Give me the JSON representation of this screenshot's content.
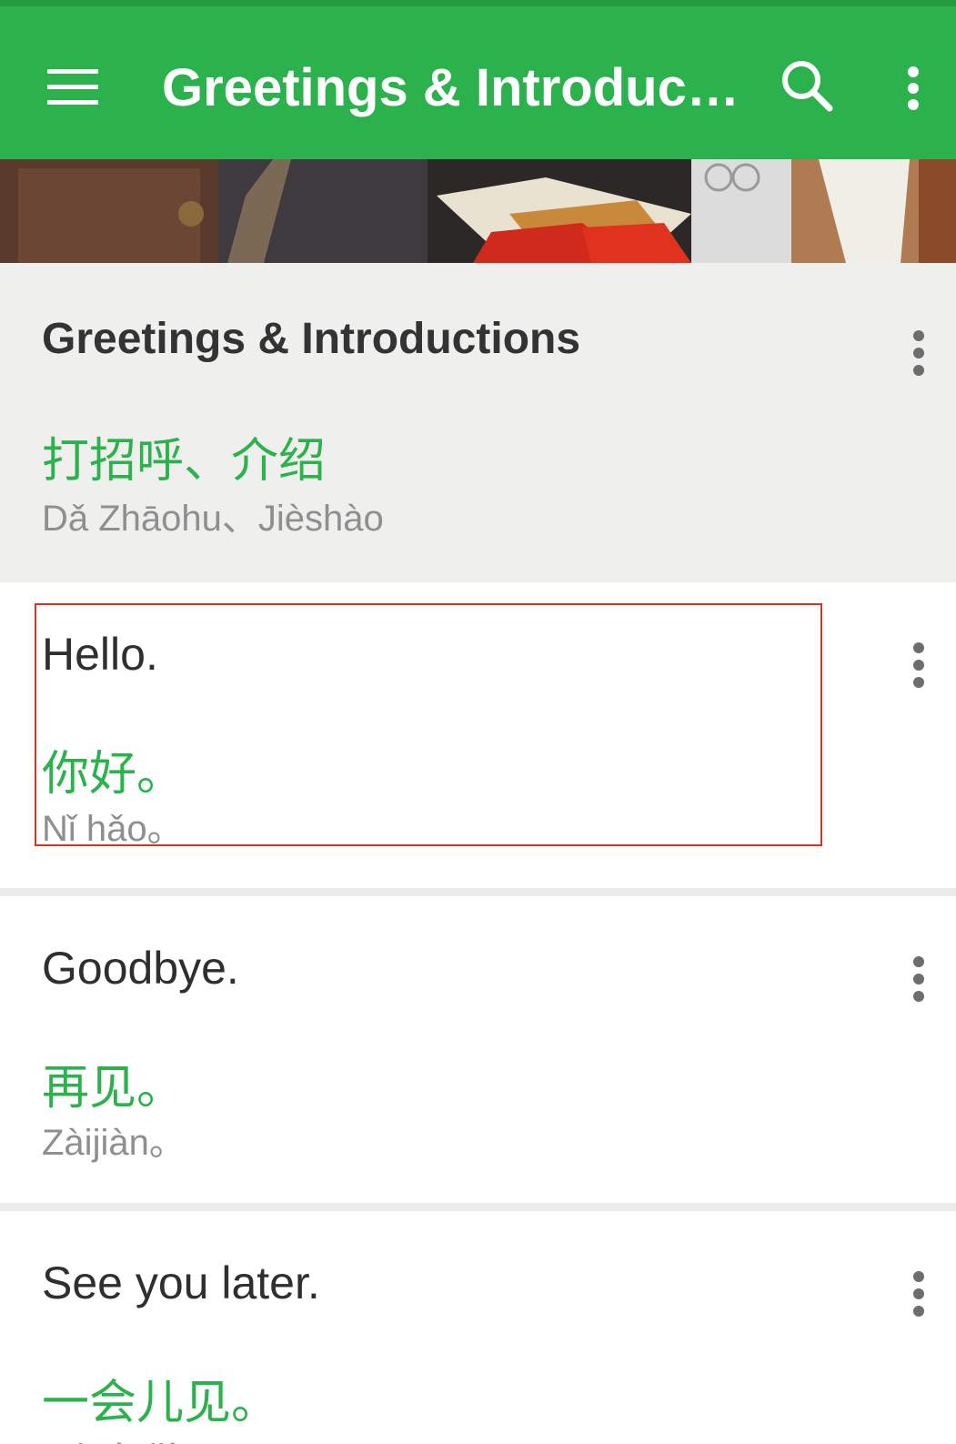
{
  "appbar": {
    "title": "Greetings & Introductions",
    "menu_icon": "hamburger-menu-icon",
    "search_icon": "search-icon",
    "overflow_icon": "more-vertical-icon",
    "color": "#2bb24c"
  },
  "category": {
    "title": "Greetings & Introductions",
    "chinese": "打招呼、介绍",
    "pinyin": "Dǎ Zhāohu、Jièshào"
  },
  "phrases": [
    {
      "english": "Hello.",
      "chinese": "你好。",
      "pinyin": "Nǐ hǎo。"
    },
    {
      "english": "Goodbye.",
      "chinese": "再见。",
      "pinyin": "Zàijiàn。"
    },
    {
      "english": "See you later.",
      "chinese": "一会儿见。",
      "pinyin": "Yīhuìr jiàn。"
    }
  ],
  "colors": {
    "accent_green": "#2bb24c",
    "header_background": "#efefed",
    "highlight_border": "#d9321f"
  }
}
